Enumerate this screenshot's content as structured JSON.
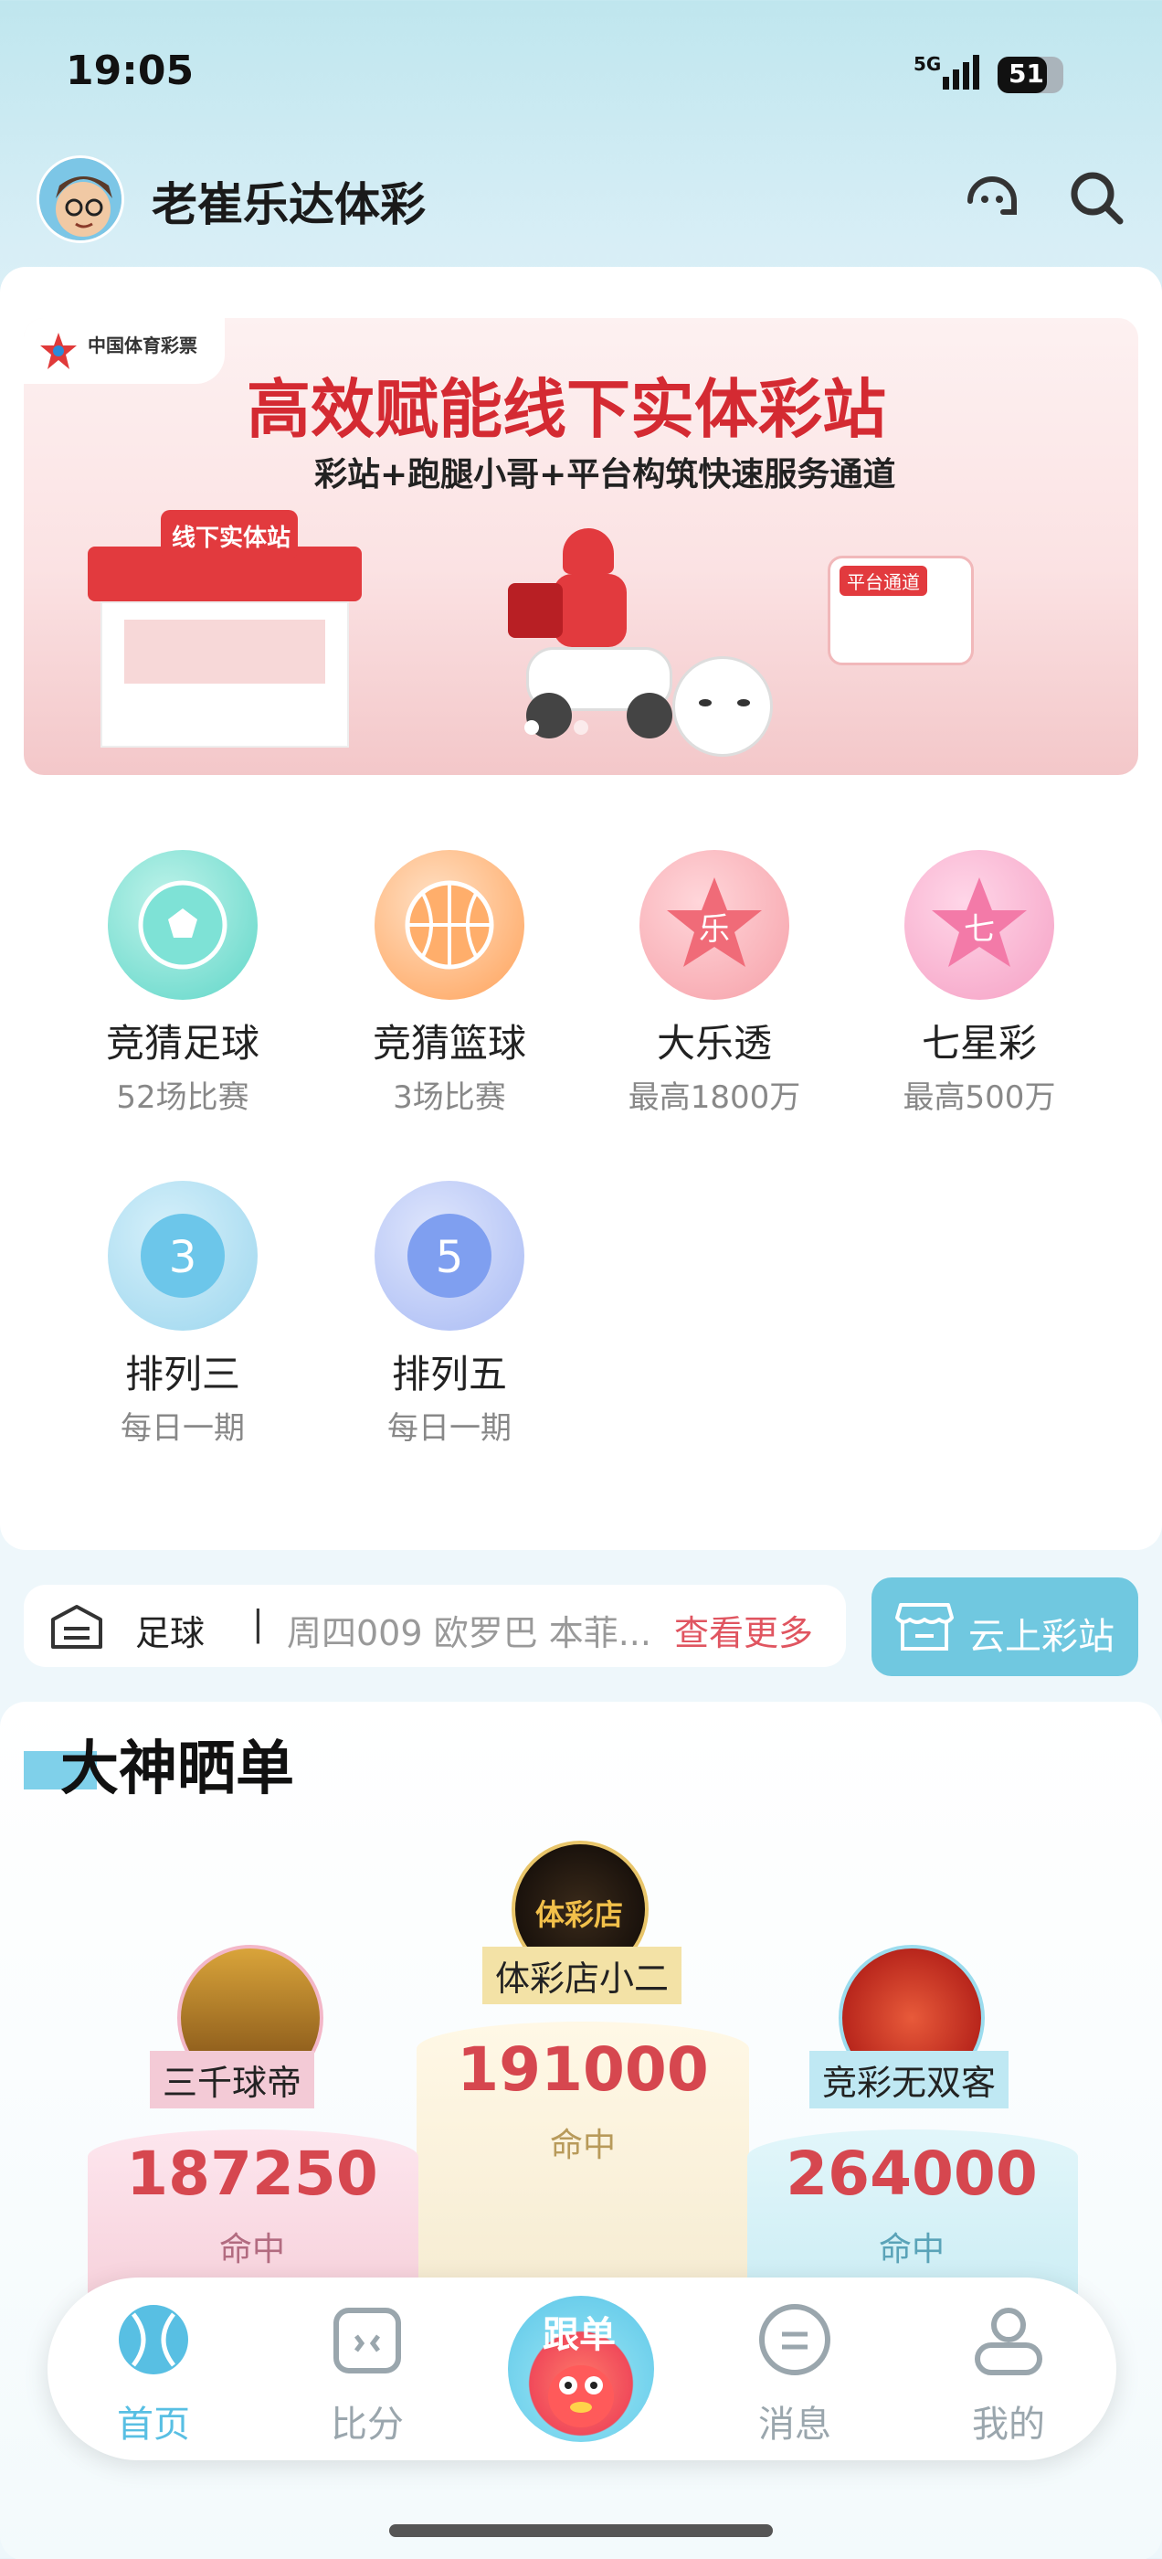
{
  "status_bar": {
    "time": "19:05",
    "network": "5G",
    "battery": "51"
  },
  "header": {
    "shop_name": "老崔乐达体彩"
  },
  "banner": {
    "logo_text": "中国体育彩票",
    "title": "高效赋能线下实体彩站",
    "subtitle": "彩站+跑腿小哥+平台构筑快速服务通道",
    "store_sign": "线下实体站",
    "platform_sign": "平台通道",
    "page_count": 2,
    "active_page": 1
  },
  "games": [
    {
      "name": "竞猜足球",
      "desc": "52场比赛",
      "icon": "soccer-ball-icon",
      "color": "#5fd6c8"
    },
    {
      "name": "竞猜篮球",
      "desc": "3场比赛",
      "icon": "basketball-icon",
      "color": "#ffa25a"
    },
    {
      "name": "大乐透",
      "desc": "最高1800万",
      "icon": "star-le-icon",
      "color": "#f06b78"
    },
    {
      "name": "七星彩",
      "desc": "最高500万",
      "icon": "star-qi-icon",
      "color": "#f37aa8"
    },
    {
      "name": "排列三",
      "desc": "每日一期",
      "icon": "ball-3-icon",
      "color": "#6cc6ea"
    },
    {
      "name": "排列五",
      "desc": "每日一期",
      "icon": "ball-5-icon",
      "color": "#7f9ff0"
    }
  ],
  "notice": {
    "category": "足球",
    "separator": "|",
    "text": "周四009 欧罗巴 本菲...",
    "more": "查看更多"
  },
  "cloud_store": {
    "label": "云上彩站"
  },
  "god_share": {
    "title": "大神晒单",
    "winners": [
      {
        "rank": 1,
        "name": "体彩店小二",
        "amount": "191000",
        "label": "命中"
      },
      {
        "rank": 2,
        "name": "三千球帝",
        "amount": "187250",
        "label": "命中"
      },
      {
        "rank": 3,
        "name": "竞彩无双客",
        "amount": "264000",
        "label": "命中"
      }
    ]
  },
  "tabbar": {
    "home": "首页",
    "score": "比分",
    "follow": "跟单",
    "messages": "消息",
    "mine": "我的",
    "active": "首页",
    "active_color": "#58bfe3",
    "inactive_color": "#9aa6ad"
  }
}
